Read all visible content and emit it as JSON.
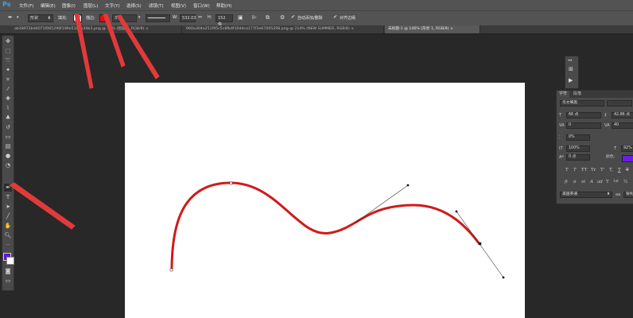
{
  "app": {
    "logo": "Ps"
  },
  "menu": [
    "文件(F)",
    "编辑(E)",
    "图像(I)",
    "图层(L)",
    "文字(Y)",
    "选择(S)",
    "滤镜(T)",
    "视图(V)",
    "窗口(W)",
    "帮助(H)"
  ],
  "options": {
    "tool_mode": "形状",
    "fill_label": "填充:",
    "stroke_label": "描边:",
    "stroke_color": "#e01010",
    "stroke_width": "3 点",
    "w_label": "W:",
    "w_value": "532.03",
    "h_label": "H:",
    "h_value": "152 像",
    "auto_add_delete": "自动添加/删除",
    "align_edges": "对齐边缘"
  },
  "tabs": [
    {
      "label": "ab18972bd4071f065296f199e510eb30b3.png @ 78% (图层 1, RGB/8)",
      "close": "×"
    },
    {
      "label": "960a304a251f95c5c8fb4f10ddca177f3e67095298.png @ 214% (NEW SUMMER, RGB/8)",
      "close": "×"
    },
    {
      "label": "未标题-1 @ 146% (形状 1, RGB/8)",
      "close": "×",
      "active": true
    }
  ],
  "char_panel": {
    "tabs": [
      "字符",
      "段落"
    ],
    "font_family": "华文细黑",
    "font_style": "-",
    "font_size": "66 点",
    "leading": "42.86 点",
    "kerning": "0",
    "tracking": "40",
    "vscale_pct": "0%",
    "h_scale": "100%",
    "v_scale": "92%",
    "baseline": "0 点",
    "color_label": "颜色:",
    "color": "#6a1ee6",
    "style_buttons": [
      "T",
      "T",
      "TT",
      "Tr",
      "T'",
      "T,",
      "T",
      "T"
    ],
    "opentype_buttons": [
      "fi",
      "σ",
      "st",
      "A",
      "ad",
      "T",
      "1st",
      "½"
    ],
    "language": "美国英语",
    "aa": "锐利"
  },
  "colors": {
    "foreground": "#5b18d6",
    "background": "#ffffff",
    "curve": "#d01a1a",
    "annotation_arrow": "#e23a3a"
  }
}
